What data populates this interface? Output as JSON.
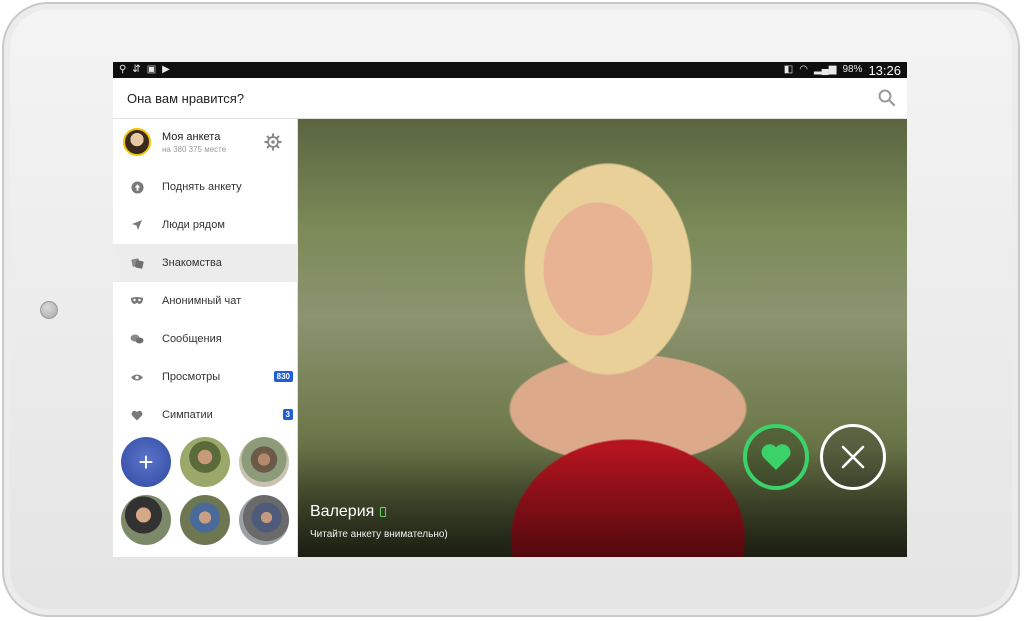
{
  "status_bar": {
    "left_icons": [
      "usb-icon",
      "sync-icon",
      "image-icon",
      "media-icon"
    ],
    "right_icons": [
      "nfc-icon",
      "wifi-icon",
      "signal-icon"
    ],
    "battery": "98%",
    "time": "13:26"
  },
  "appbar": {
    "title": "Она вам нравится?",
    "search_icon": "search-icon"
  },
  "profile": {
    "name": "Моя анкета",
    "rank": "на 380 375 месте",
    "settings_icon": "gear-icon"
  },
  "menu": [
    {
      "icon": "arrow-up-circle-icon",
      "label": "Поднять анкету",
      "badge": ""
    },
    {
      "icon": "location-arrow-icon",
      "label": "Люди рядом",
      "badge": ""
    },
    {
      "icon": "cards-icon",
      "label": "Знакомства",
      "badge": "",
      "active": true
    },
    {
      "icon": "mask-icon",
      "label": "Анонимный чат",
      "badge": ""
    },
    {
      "icon": "chat-bubbles-icon",
      "label": "Сообщения",
      "badge": ""
    },
    {
      "icon": "eye-icon",
      "label": "Просмотры",
      "badge": "830"
    },
    {
      "icon": "heart-icon",
      "label": "Симпатии",
      "badge": "3"
    }
  ],
  "thumbs_add_label": "+",
  "card": {
    "name": "Валерия",
    "subtitle": "Читайте анкету внимательно)",
    "online_icon": "mobile-phone-icon"
  },
  "colors": {
    "like": "#3bd26a",
    "badge": "#1e5fd6",
    "dress": "#b3141e"
  }
}
